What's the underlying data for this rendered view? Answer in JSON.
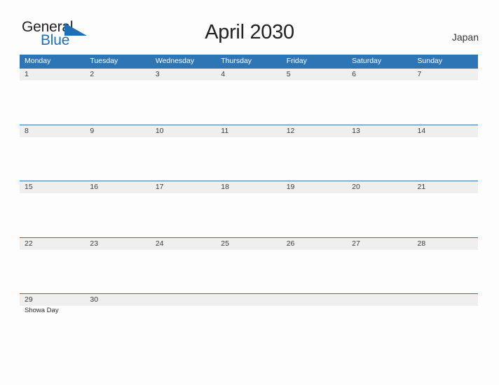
{
  "brand": {
    "name_part1": "General",
    "name_part2": "Blue",
    "flag_icon": "blue-triangle-flag-icon",
    "accent_color": "#1f6fb5"
  },
  "header": {
    "title": "April 2030",
    "country": "Japan"
  },
  "theme": {
    "header_blue": "#2e75b6",
    "band_gray": "#efefef",
    "page_background": "#fdfdfd",
    "text_dark": "#3a3a3a"
  },
  "calendar": {
    "month": "April",
    "year": "2030",
    "weekday_headers": [
      "Monday",
      "Tuesday",
      "Wednesday",
      "Thursday",
      "Friday",
      "Saturday",
      "Sunday"
    ],
    "weeks": [
      {
        "days": [
          {
            "num": "1",
            "event": ""
          },
          {
            "num": "2",
            "event": ""
          },
          {
            "num": "3",
            "event": ""
          },
          {
            "num": "4",
            "event": ""
          },
          {
            "num": "5",
            "event": ""
          },
          {
            "num": "6",
            "event": ""
          },
          {
            "num": "7",
            "event": ""
          }
        ]
      },
      {
        "days": [
          {
            "num": "8",
            "event": ""
          },
          {
            "num": "9",
            "event": ""
          },
          {
            "num": "10",
            "event": ""
          },
          {
            "num": "11",
            "event": ""
          },
          {
            "num": "12",
            "event": ""
          },
          {
            "num": "13",
            "event": ""
          },
          {
            "num": "14",
            "event": ""
          }
        ]
      },
      {
        "days": [
          {
            "num": "15",
            "event": ""
          },
          {
            "num": "16",
            "event": ""
          },
          {
            "num": "17",
            "event": ""
          },
          {
            "num": "18",
            "event": ""
          },
          {
            "num": "19",
            "event": ""
          },
          {
            "num": "20",
            "event": ""
          },
          {
            "num": "21",
            "event": ""
          }
        ]
      },
      {
        "days": [
          {
            "num": "22",
            "event": ""
          },
          {
            "num": "23",
            "event": ""
          },
          {
            "num": "24",
            "event": ""
          },
          {
            "num": "25",
            "event": ""
          },
          {
            "num": "26",
            "event": ""
          },
          {
            "num": "27",
            "event": ""
          },
          {
            "num": "28",
            "event": ""
          }
        ]
      },
      {
        "days": [
          {
            "num": "29",
            "event": "Showa Day"
          },
          {
            "num": "30",
            "event": ""
          },
          {
            "num": "",
            "event": ""
          },
          {
            "num": "",
            "event": ""
          },
          {
            "num": "",
            "event": ""
          },
          {
            "num": "",
            "event": ""
          },
          {
            "num": "",
            "event": ""
          }
        ]
      }
    ]
  }
}
